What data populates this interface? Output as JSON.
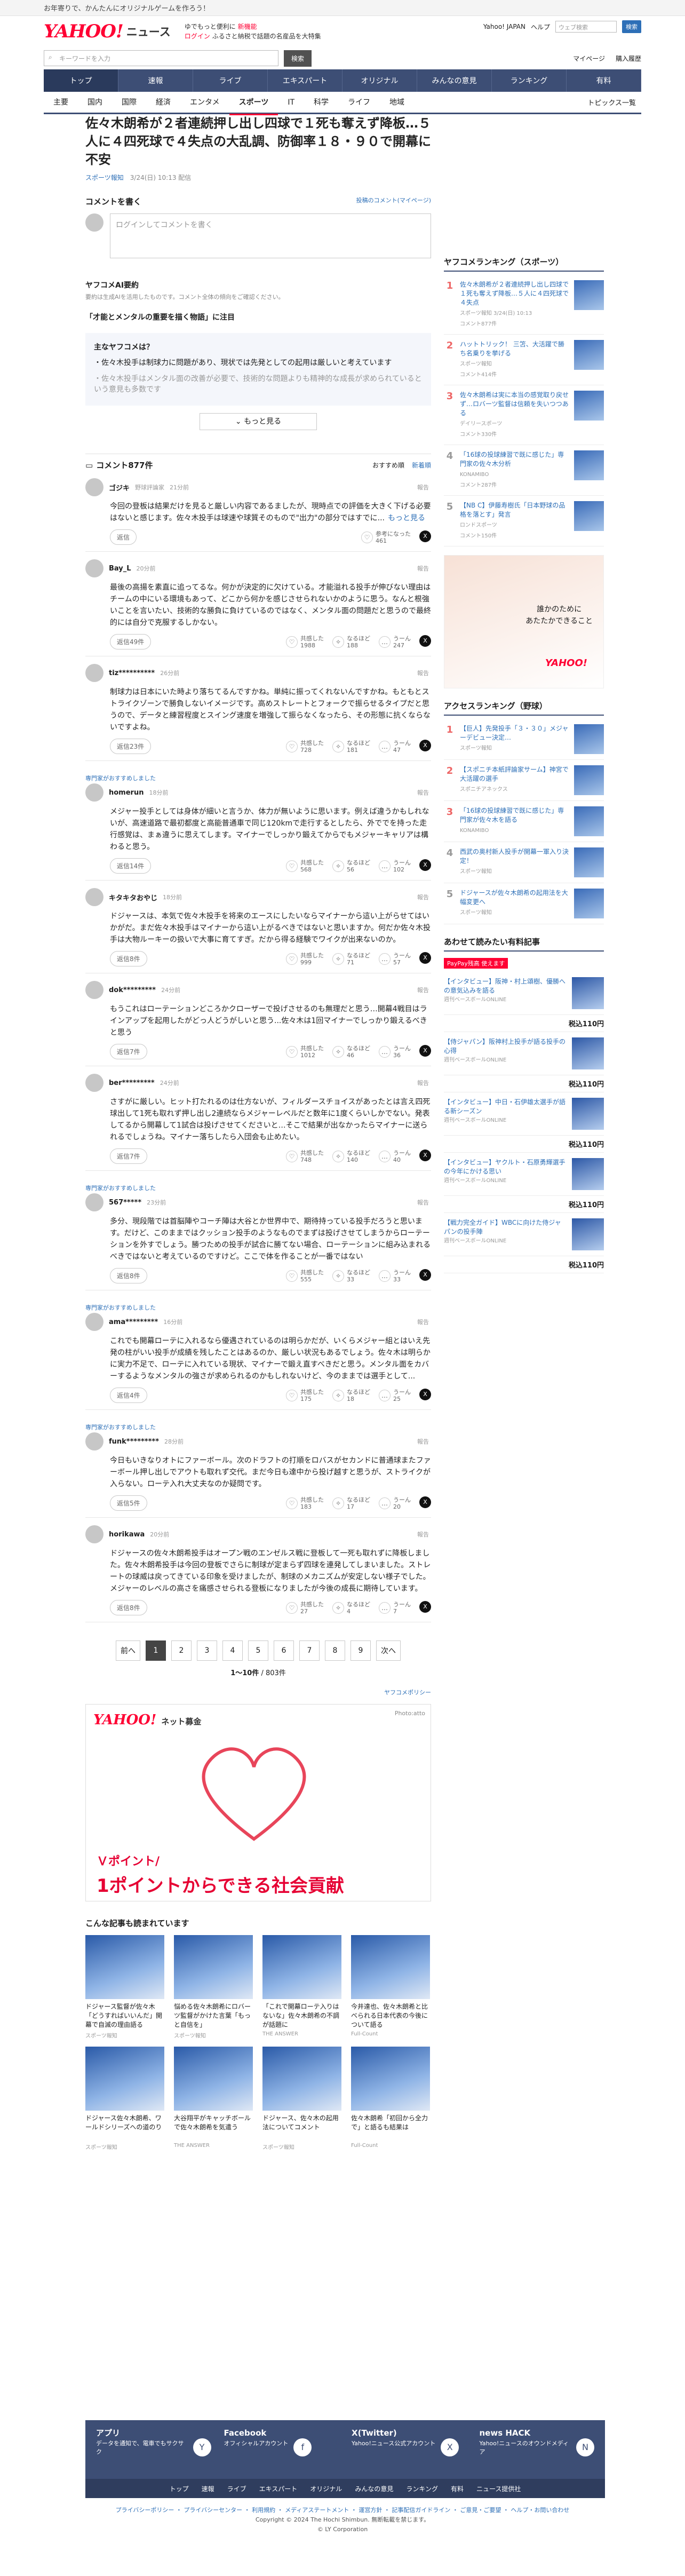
{
  "promo": "お年寄りで、かんたんにオリジナルゲームを作ろう！",
  "header": {
    "logo": "YAHOO!",
    "section": "ニュース",
    "links": [
      "ゆでもっと便利に",
      "新機能",
      "ログイン",
      "ふるさと納税で話題の名産品を大特集"
    ],
    "right_links": [
      "Yahoo! JAPAN",
      "ヘルプ"
    ],
    "search_placeholder": "ウェブ検索",
    "search_button": "検索"
  },
  "searchrow": {
    "placeholder": "キーワードを入力",
    "button": "検索",
    "links": [
      "マイページ",
      "購入履歴"
    ]
  },
  "nav": [
    "トップ",
    "速報",
    "ライブ",
    "エキスパート",
    "オリジナル",
    "みんなの意見",
    "ランキング",
    "有料"
  ],
  "subnav": [
    "主要",
    "国内",
    "国際",
    "経済",
    "エンタメ",
    "スポーツ",
    "IT",
    "科学",
    "ライフ",
    "地域"
  ],
  "subnav_right": "トピックス一覧",
  "article": {
    "title": "佐々木朗希が２者連続押し出し四球で１死も奪えず降板…５人に４四死球で４失点の大乱調、防御率１８・９０で開幕に不安",
    "source": "スポーツ報知",
    "date": "3/24(日) 10:13 配信"
  },
  "comment_write": {
    "heading": "コメントを書く",
    "policy_link": "投稿のコメント(マイページ)",
    "placeholder": "ログインしてコメントを書く"
  },
  "ai": {
    "heading": "ヤフコメAI要約",
    "sub": "要約は生成AIを活用したものです。コメント全体の傾向をご確認ください。",
    "question": "「才能とメンタルの重要を描く物語」に注目",
    "box_title": "主なヤフコメは？",
    "points": [
      "佐々木投手は制球力に問題があり、現状では先発としての起用は厳しいと考えています",
      "佐々木投手はメンタル面の改善が必要で、技術的な問題よりも精神的な成長が求められているという意見も多数です"
    ],
    "more": "もっと見る"
  },
  "comments_header": {
    "title": "コメント877件",
    "sort": [
      "おすすめ順",
      "新着順"
    ]
  },
  "comments": [
    {
      "name": "ゴジキ",
      "time": "21分前",
      "report": "報告",
      "badge": "野球評論家",
      "body": "今回の登板は結果だけを見ると厳しい内容であるましたが、現時点での評価を大きく下げる必要はないと感じます。佐々木投手は球速や球質そのもので\"出力\"の部分ではすでに...",
      "more": "もっと見る",
      "reply": "返信",
      "votes": [
        {
          "label": "参考になった",
          "count": "461"
        }
      ]
    },
    {
      "name": "Bay_L",
      "time": "20分前",
      "report": "報告",
      "body": "最後の高揚を素直に追ってるな。何かが決定的に欠けている。才能溢れる投手が伸びない理由はチームの中にいる環境もあって、どこから何かを感じさせられないかのように思う。なんと根強いことを言いたい、技術的な勝負に負けているのではなく、メンタル面の問題だと思うので最終的には自分で克服するしかない。",
      "reply": "返信49件",
      "votes": [
        {
          "label": "共感した",
          "count": "1988"
        },
        {
          "label": "なるほど",
          "count": "188"
        },
        {
          "label": "うーん",
          "count": "247"
        }
      ]
    },
    {
      "name": "tiz**********",
      "time": "26分前",
      "report": "報告",
      "body": "制球力は日本にいた時より落ちてるんですかね。単純に振ってくれないんですかね。もともとストライクゾーンで勝負しないイメージです。高めストレートとフォークで振らせるタイプだと思うので、データと練習程度とスイング速度を増強して振らなくなったら、その形態に抗くならないですよね。",
      "reply": "返信23件",
      "votes": [
        {
          "label": "共感した",
          "count": "728"
        },
        {
          "label": "なるほど",
          "count": "181"
        },
        {
          "label": "うーん",
          "count": "47"
        }
      ]
    },
    {
      "name": "homerun",
      "time": "18分前",
      "report": "報告",
      "note": "専門家がおすすめしました",
      "body": "メジャー投手としては身体が細いと言うか、体力が無いように思います。例えば違うかもしれないが、高速道路で最初都度と高能普通車で同じ120kmで走行するとしたら、外ででを持った走行感覚は、まぁ違うに思えてします。マイナーでしっかり鍛えてからでもメジャーキャリアは構わると思う。",
      "reply": "返信14件",
      "votes": [
        {
          "label": "共感した",
          "count": "568"
        },
        {
          "label": "なるほど",
          "count": "56"
        },
        {
          "label": "うーん",
          "count": "102"
        }
      ]
    },
    {
      "name": "キタキタおやじ",
      "time": "18分前",
      "report": "報告",
      "body": "ドジャースは、本気で佐々木投手を将来のエースにしたいならマイナーから這い上がらせてはいかがだ。まだ佐々木投手はマイナーから這い上がるべきではないと思いますか。何だか佐々木投手は大物ルーキーの扱いで大事に育てすぎ。だから得る経験でワイクが出来ないのか。",
      "reply": "返信8件",
      "votes": [
        {
          "label": "共感した",
          "count": "999"
        },
        {
          "label": "なるほど",
          "count": "71"
        },
        {
          "label": "うーん",
          "count": "57"
        }
      ]
    },
    {
      "name": "dok*********",
      "time": "24分前",
      "report": "報告",
      "body": "もうこれはローテーションどころかクローザーで投げさせるのも無理だと思う…開幕4戦目はラインアップを起用したがどっ人どうがしいと思う...佐々木は1回マイナーでしっかり鍛えるべきと思う",
      "reply": "返信7件",
      "votes": [
        {
          "label": "共感した",
          "count": "1012"
        },
        {
          "label": "なるほど",
          "count": "46"
        },
        {
          "label": "うーん",
          "count": "36"
        }
      ]
    },
    {
      "name": "ber*********",
      "time": "24分前",
      "report": "報告",
      "body": "さすがに厳しい。ヒット打たれるのは仕方ないが、フィルダースチョイスがあったとは言え四死球出して1死も取れず押し出し2連続ならメジャーレベルだと数年に1度くらいしかでない。発表してるから開幕して1試合は投げさせてくださいと…そこで結果が出なかったらマイナーに送られるでしょうね。マイナー落ちしたら入団会も止めたい。",
      "reply": "返信7件",
      "votes": [
        {
          "label": "共感した",
          "count": "748"
        },
        {
          "label": "なるほど",
          "count": "140"
        },
        {
          "label": "うーん",
          "count": "40"
        }
      ]
    },
    {
      "name": "567*****",
      "time": "23分前",
      "report": "報告",
      "note": "専門家がおすすめしました",
      "body": "多分、現段階では首脳陣やコーチ陣は大谷とか世界中で、期待持っている投手だろうと思います。だけど、このままではクッション投手のようなものでまずは投げさせてしまうからローテーションを外すでしょう。勝つための投手が試合に勝てない場合、ローテーションに組み込まれるべきではないと考えているのですけど。ここで体を作ることが一番ではない",
      "reply": "返信8件",
      "votes": [
        {
          "label": "共感した",
          "count": "555"
        },
        {
          "label": "なるほど",
          "count": "33"
        },
        {
          "label": "うーん",
          "count": "33"
        }
      ]
    },
    {
      "name": "ama*********",
      "time": "16分前",
      "report": "報告",
      "note": "専門家がおすすめしました",
      "body": "これでも開幕ローテに入れるなら優遇されているのは明らかだが、いくらメジャー組とはいえ先発の柱がいい投手が成績を残したことはあるのか、厳しい状況もあるでしょう。佐々木は明らかに実力不足で、ローテに入れている現状、マイナーで鍛え直すべきだと思う。メンタル面をカバーするようなメンタルの強さが求められるのかもしれないけど、今のままでは選手として...",
      "reply": "返信4件",
      "votes": [
        {
          "label": "共感した",
          "count": "175"
        },
        {
          "label": "なるほど",
          "count": "18"
        },
        {
          "label": "うーん",
          "count": "25"
        }
      ]
    },
    {
      "name": "funk*********",
      "time": "28分前",
      "report": "報告",
      "note": "専門家がおすすめしました",
      "body": "今日もいきなりオトにファーボール。次のドラフトの打順をロバスがセカンドに普通球またファーボール押し出しでアウトも取れず交代。まだ今日も達中から投げ越すと思うが、ストライクが入らない。ローテ入れ大丈夫なのか疑問です。",
      "reply": "返信5件",
      "votes": [
        {
          "label": "共感した",
          "count": "183"
        },
        {
          "label": "なるほど",
          "count": "17"
        },
        {
          "label": "うーん",
          "count": "20"
        }
      ]
    },
    {
      "name": "horikawa",
      "time": "20分前",
      "report": "報告",
      "body": "ドジャースの佐々木朗希投手はオープン戦のエンゼルス戦に登板して一死も取れずに降板しました。佐々木朗希投手は今回の登板でさらに制球が定まらず四球を連発してしまいました。ストレートの球威は戻ってきている印象を受けましたが、制球のメカニズムが安定しない様子でした。メジャーのレベルの高さを痛感させられる登板になりましたが今後の成長に期待しています。",
      "reply": "返信8件",
      "votes": [
        {
          "label": "共感した",
          "count": "27"
        },
        {
          "label": "なるほど",
          "count": "4"
        },
        {
          "label": "うーん",
          "count": "7"
        }
      ]
    }
  ],
  "pager": {
    "prev": "前へ",
    "pages": [
      "1",
      "2",
      "3",
      "4",
      "5",
      "6",
      "7",
      "8",
      "9"
    ],
    "next": "次へ",
    "count": "1〜10件",
    "total": "/ 803件"
  },
  "policy": "ヤフコメポリシー",
  "ad": {
    "brand": "YAHOO!",
    "brand_sub": "ネット募金",
    "sponsor": "Photo:atto",
    "line1": "Ｖポイント/",
    "line2": "1ポイントからできる社会貢献"
  },
  "reco": {
    "heading": "こんな記事も読まれています",
    "items": [
      {
        "title": "ドジャース監督が佐々木「どうすればいいんだ」開幕で自滅の理由語る",
        "src": "スポーツ報知"
      },
      {
        "title": "悩める佐々木朗希にロバーツ監督がかけた言葉「もっと自信を」",
        "src": "スポーツ報知"
      },
      {
        "title": "「これで開幕ローテ入りはないな」佐々木朗希の不調が話題に",
        "src": "THE ANSWER"
      },
      {
        "title": "今井達也、佐々木朗希と比べられる日本代表の今後について語る",
        "src": "Full-Count"
      },
      {
        "title": "ドジャース佐々木朗希、ワールドシリーズへの道のり",
        "src": "スポーツ報知"
      },
      {
        "title": "大谷翔平がキャッチボールで佐々木朗希を気遣う",
        "src": "THE ANSWER"
      },
      {
        "title": "ドジャース、佐々木の起用法についてコメント",
        "src": "スポーツ報知"
      },
      {
        "title": "佐々木朗希「初回から全力で」と語るも結果は",
        "src": "Full-Count"
      }
    ]
  },
  "side": {
    "ranking_heading": "ヤフコメランキング（スポーツ）",
    "ranking": [
      {
        "n": "1",
        "t": "佐々木朗希が２者連続押し出し四球で１死も奪えず降板…５人に４四死球で４失点",
        "s": "スポーツ報知 3/24(日) 10:13",
        "c": "コメント877件"
      },
      {
        "n": "2",
        "t": "ハットトリック！ 三笘、大活躍で勝ち名乗りを挙げる",
        "s": "スポーツ報知",
        "c": "コメント414件"
      },
      {
        "n": "3",
        "t": "佐々木朗希は実に本当の感覚取り戻せず…ロバーツ監督は信頼を失いつつある",
        "s": "デイリースポーツ",
        "c": "コメント330件"
      },
      {
        "n": "4",
        "t": "「16球の投球練習で既に感じた」専門家の佐々木分析",
        "s": "KONAMIBO",
        "c": "コメント287件"
      },
      {
        "n": "5",
        "t": "【NB C】伊藤寿樹氏「日本野球の品格を落とす」発言",
        "s": "ロンドスポーツ",
        "c": "コメント150件"
      }
    ],
    "ad_text": "誰かのために\nあたたかできること",
    "ad_logo": "YAHOO!",
    "access_heading": "アクセスランキング（野球）",
    "access": [
      {
        "n": "1",
        "t": "【巨人】先発投手「３・３０」メジャーデビュー決定…",
        "s": "スポーツ報知"
      },
      {
        "n": "2",
        "t": "【スポニチ本紙評論家サーム】神宮で大活躍の選手",
        "s": "スポニチアネックス"
      },
      {
        "n": "3",
        "t": "「16球の投球練習で既に感じた」専門家が佐々木を語る",
        "s": "KONAMIBO"
      },
      {
        "n": "4",
        "t": "西武の奥村新人投手が開幕一軍入り決定！",
        "s": "スポーツ報知"
      },
      {
        "n": "5",
        "t": "ドジャースが佐々木朗希の起用法を大幅変更へ",
        "s": "スポーツ報知"
      }
    ],
    "shop_heading": "あわせて読みたい有料記事",
    "paypay": "PayPay残高 使えます",
    "shop": [
      {
        "t": "【インタビュー】阪神・村上頌樹、優勝への意気込みを語る",
        "s": "週刊ベースボールONLINE",
        "p": "税込110円"
      },
      {
        "t": "【侍ジャパン】阪神村上投手が語る投手の心得",
        "s": "週刊ベースボールONLINE",
        "p": "税込110円"
      },
      {
        "t": "【インタビュー】中日・石伊雄太選手が語る新シーズン",
        "s": "週刊ベースボールONLINE",
        "p": "税込110円"
      },
      {
        "t": "【インタビュー】ヤクルト・石原勇輝選手の今年にかける思い",
        "s": "週刊ベースボールONLINE",
        "p": "税込110円"
      },
      {
        "t": "【戦力完全ガイド】WBCに向けた侍ジャパンの投手陣",
        "s": "週刊ベースボールONLINE",
        "p": "税込110円"
      }
    ]
  },
  "footer": {
    "apps": [
      {
        "title": "アプリ",
        "desc": "データを通知で、電車でもサクサク",
        "icon": "Y"
      },
      {
        "title": "Facebook",
        "desc": "オフィシャルアカウント",
        "icon": "f"
      },
      {
        "title": "X(Twitter)",
        "desc": "Yahoo!ニュース公式アカウント",
        "icon": "X"
      },
      {
        "title": "news HACK",
        "desc": "Yahoo!ニュースのオウンドメディア",
        "icon": "N"
      }
    ],
    "nav": [
      "トップ",
      "速報",
      "ライブ",
      "エキスパート",
      "オリジナル",
      "みんなの意見",
      "ランキング",
      "有料",
      "ニュース提供社"
    ],
    "bottom_links": "プライバシーポリシー ・ プライバシーセンター ・ 利用規約 ・ メディアステートメント ・ 運営方針 ・ 記事配信ガイドライン ・ ご意見・ご要望 ・ ヘルプ・お問い合わせ",
    "copyright1": "Copyright © 2024 The Hochi Shimbun. 無断転載を禁じます。",
    "copyright2": "© LY Corporation"
  }
}
